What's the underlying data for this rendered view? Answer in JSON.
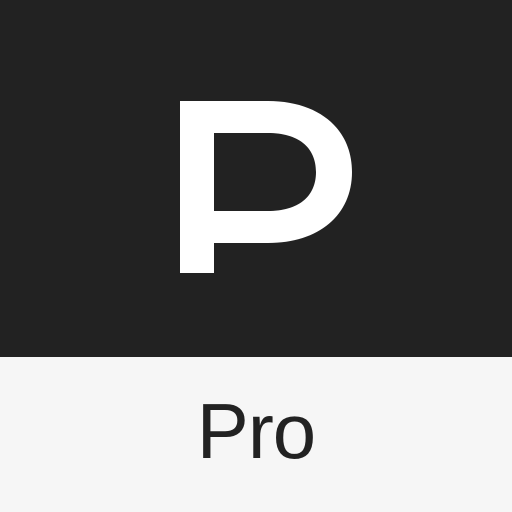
{
  "icon": {
    "logo_letter": "P",
    "edition_label": "Pro",
    "colors": {
      "top_background": "#222222",
      "logo_mark": "#ffffff",
      "bottom_background": "#f6f6f6",
      "label_text": "#222222"
    }
  }
}
